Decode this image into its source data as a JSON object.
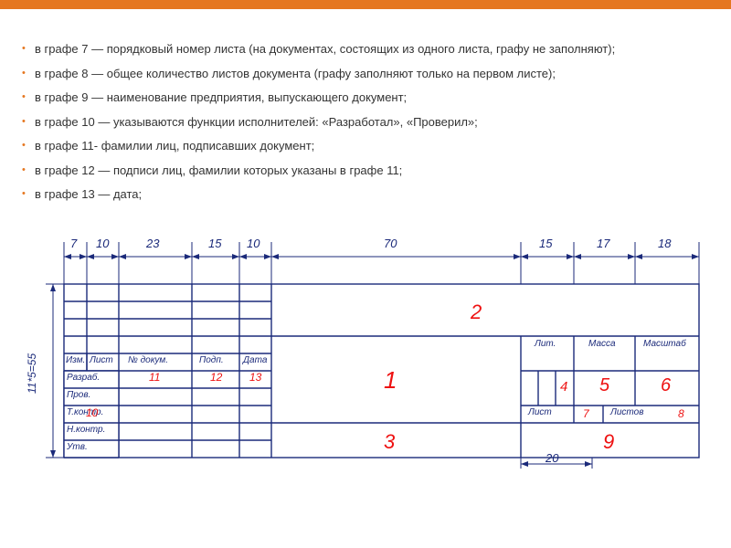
{
  "bullets": {
    "b1": "в графе 7 — порядковый номер листа (на документах, состоящих из одного листа, графу не заполняют);",
    "b2": "в графе 8 — общее количество листов документа (графу заполняют только на первом листе);",
    "b3": "в графе 9 — наименование предприятия, выпускающего документ;",
    "b4": "в графе 10 — указываются функции исполнителей: «Разработал», «Проверил»;",
    "b5": "в графе 11- фамилии лиц, подписавших документ;",
    "b6": "в графе 12 — подписи лиц, фамилии которых указаны в графе 11;",
    "b7": "в графе 13 — дата;"
  },
  "dims": {
    "top": {
      "d1": "7",
      "d2": "10",
      "d3": "23",
      "d4": "15",
      "d5": "10",
      "d6": "70",
      "d7": "15",
      "d8": "17",
      "d9": "18"
    },
    "side": "11*5=55",
    "bottom": "20"
  },
  "rows": {
    "r1": "Изм.",
    "r1b": "Лист",
    "r1c": "№ докум.",
    "r1d": "Подп.",
    "r1e": "Дата",
    "r2": "Разраб.",
    "r3": "Пров.",
    "r4": "Т.контр.",
    "r5": "Н.контр.",
    "r6": "Утв."
  },
  "cells": {
    "c11": "11",
    "c12": "12",
    "c13": "13",
    "c10": "10",
    "lit": "Лит.",
    "massa": "Масса",
    "mash": "Масштаб",
    "list": "Лист",
    "listov": "Листов",
    "z1": "1",
    "z2": "2",
    "z3": "3",
    "z4": "4",
    "z5": "5",
    "z6": "6",
    "z7": "7",
    "z8": "8",
    "z9": "9"
  }
}
